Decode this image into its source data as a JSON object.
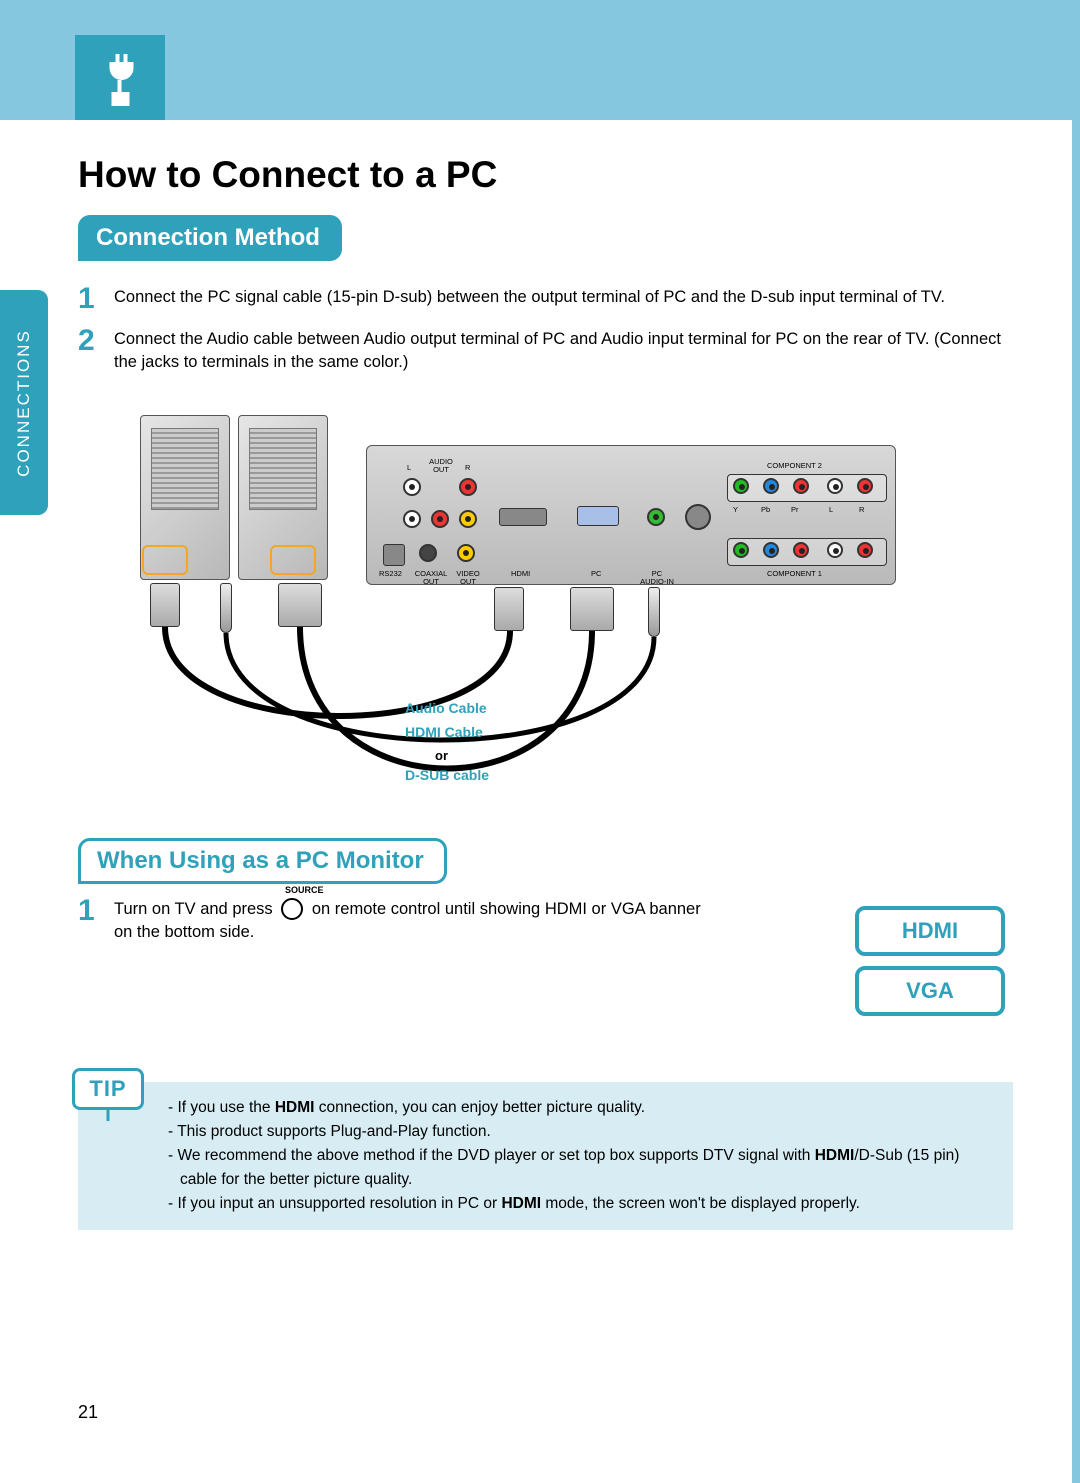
{
  "side_tab": "CONNECTIONS",
  "page_title": "How to Connect to a PC",
  "sections": {
    "connection_method": {
      "heading": "Connection Method",
      "steps": [
        {
          "num": "1",
          "text": "Connect the PC signal cable (15-pin D-sub) between the output terminal of PC and the D-sub input terminal of TV."
        },
        {
          "num": "2",
          "text": "Connect the Audio cable between Audio output terminal of PC and Audio input terminal for PC on the rear of TV. (Connect the jacks to terminals in the same color.)"
        }
      ]
    },
    "pc_monitor": {
      "heading": "When Using as a PC Monitor",
      "source_label": "SOURCE",
      "step": {
        "num": "1",
        "text_before": "Turn on TV and press ",
        "text_after": " on remote control until showing HDMI or VGA banner on the bottom side."
      }
    }
  },
  "diagram": {
    "panel_labels": {
      "audio_out": "AUDIO\nOUT",
      "L": "L",
      "R": "R",
      "rs232": "RS232",
      "coaxial": "COAXIAL\nOUT",
      "video_out": "VIDEO\nOUT",
      "hdmi": "HDMI",
      "pc": "PC",
      "pc_audio": "PC\nAUDIO-IN",
      "component1": "COMPONENT 1",
      "component2": "COMPONENT 2",
      "Y": "Y",
      "Pb": "Pb",
      "Pr": "Pr"
    },
    "cable_labels": {
      "audio": "Audio Cable",
      "hdmi": "HDMI Cable",
      "or": "or",
      "dsub": "D-SUB cable"
    }
  },
  "banners": {
    "hdmi": "HDMI",
    "vga": "VGA"
  },
  "tip": {
    "badge": "TIP",
    "items": [
      "If you use the <b>HDMI</b> connection, you can enjoy better picture quality.",
      "This product supports Plug-and-Play function.",
      "We recommend the above method if the DVD player or set top box supports DTV signal with <b>HDMI</b>/D-Sub (15 pin) cable for the better picture quality.",
      "If you input an unsupported resolution in PC or <b>HDMI</b> mode, the screen won't be displayed properly."
    ]
  },
  "page_number": "21"
}
